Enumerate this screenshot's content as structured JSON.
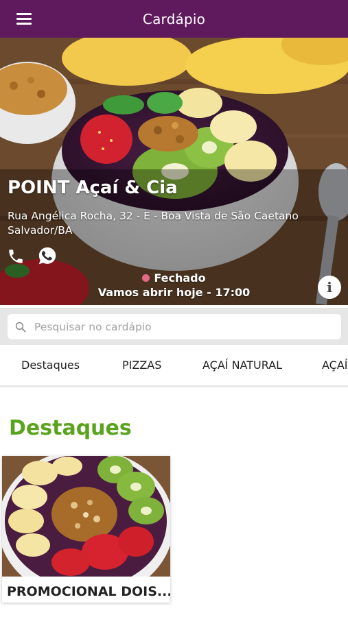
{
  "header": {
    "title": "Cardápio",
    "menu_icon": "hamburger-menu-icon"
  },
  "store": {
    "name": "POINT Açaí & Cia",
    "address_line1": "Rua Angélica Rocha, 32 - E - Boa Vista de São Caetano",
    "address_line2": "Salvador/BA",
    "status": "Fechado",
    "status_color": "#e36b86",
    "hours": "Vamos abrir hoje - 17:00"
  },
  "search": {
    "placeholder": "Pesquisar no cardápio"
  },
  "tabs": [
    {
      "label": "Destaques",
      "active": true
    },
    {
      "label": "PIZZAS",
      "active": false
    },
    {
      "label": "AÇAÍ NATURAL",
      "active": false
    },
    {
      "label": "AÇAÍ",
      "active": false
    }
  ],
  "section": {
    "title": "Destaques"
  },
  "products": [
    {
      "title": "PROMOCIONAL DOIS..."
    }
  ],
  "colors": {
    "brand": "#5e1a5c",
    "section_title": "#5aa31f",
    "whatsapp": "#25d366"
  }
}
